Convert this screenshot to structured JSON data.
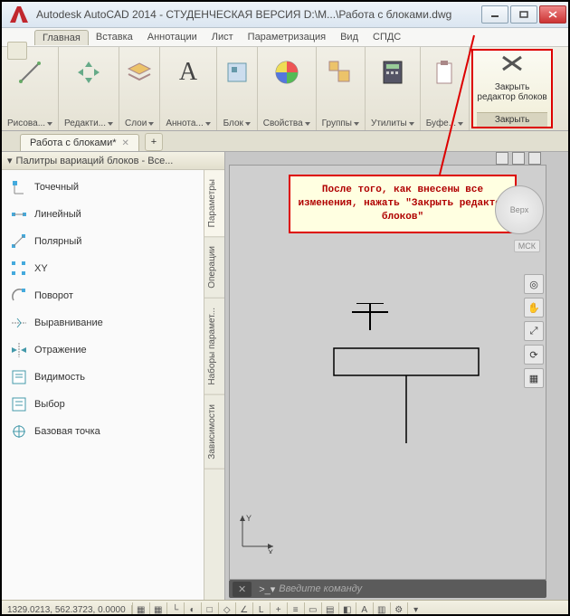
{
  "window": {
    "title": "Autodesk AutoCAD 2014 - СТУДЕНЧЕСКАЯ ВЕРСИЯ    D:\\M...\\Работа с блоками.dwg"
  },
  "menu": {
    "tabs": [
      "Главная",
      "Вставка",
      "Аннотации",
      "Лист",
      "Параметризация",
      "Вид",
      "СПДС"
    ]
  },
  "ribbon": {
    "panels": [
      {
        "label": "Рисова..."
      },
      {
        "label": "Редакти..."
      },
      {
        "label": "Слои"
      },
      {
        "label": "Аннота..."
      },
      {
        "label": "Блок"
      },
      {
        "label": "Свойства"
      },
      {
        "label": "Группы"
      },
      {
        "label": "Утилиты"
      },
      {
        "label": "Буфе..."
      }
    ],
    "close": {
      "line1": "Закрыть",
      "line2": "редактор блоков",
      "footer": "Закрыть"
    }
  },
  "doc_tab": {
    "name": "Работа с блоками*"
  },
  "palette": {
    "title": "Палитры вариаций блоков - Все...",
    "items": [
      {
        "label": "Точечный"
      },
      {
        "label": "Линейный"
      },
      {
        "label": "Полярный"
      },
      {
        "label": "XY"
      },
      {
        "label": "Поворот"
      },
      {
        "label": "Выравнивание"
      },
      {
        "label": "Отражение"
      },
      {
        "label": "Видимость"
      },
      {
        "label": "Выбор"
      },
      {
        "label": "Базовая точка"
      }
    ],
    "side_tabs": [
      "Параметры",
      "Операции",
      "Наборы парамет...",
      "Зависимости"
    ]
  },
  "callout": {
    "text": "После того, как внесены все изменения, нажать \"Закрыть редактор блоков\""
  },
  "nav": {
    "mode": "Верх",
    "wcs": "МСК"
  },
  "commandline": {
    "placeholder": "Введите команду"
  },
  "statusbar": {
    "coords": "1329.0213, 562.3723, 0.0000"
  }
}
